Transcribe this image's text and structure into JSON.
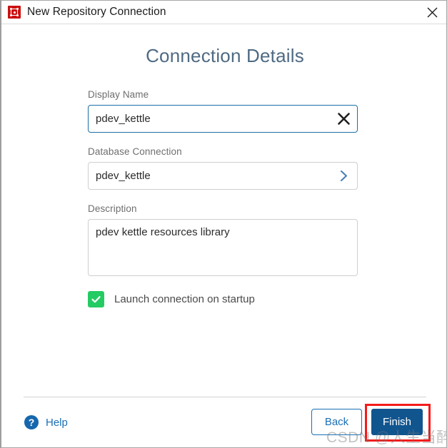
{
  "window": {
    "title": "New Repository Connection",
    "app_icon": "pentaho-kettle-icon",
    "close_label": "×"
  },
  "heading": "Connection Details",
  "form": {
    "fields": [
      {
        "label": "Display Name",
        "value": "pdev_kettle",
        "placeholder": "Display Name",
        "action_icon": "clear-icon",
        "focused": true,
        "type": "text"
      },
      {
        "label": "Database Connection",
        "value": "pdev_kettle",
        "placeholder": "Database Connection",
        "action_icon": "chevron-right-icon",
        "focused": false,
        "type": "select"
      },
      {
        "label": "Description",
        "value": "pdev kettle resources library",
        "placeholder": "Description",
        "type": "textarea"
      }
    ],
    "checkbox": {
      "label": "Launch connection on startup",
      "checked": true,
      "color": "#24cb63"
    }
  },
  "footer": {
    "help_label": "Help",
    "help_icon": "help-circle-icon",
    "back_label": "Back",
    "finish_label": "Finish"
  },
  "annotation": {
    "target": "finish-button",
    "color": "#f51a1a"
  },
  "watermark": "CSDN @人生当醉",
  "colors": {
    "accent_blue": "#1a6fb5",
    "primary_button": "#11558f",
    "heading": "#4f6a83",
    "checkbox_green": "#24cb63",
    "icon_red": "#cc1111",
    "annotation_red": "#f51a1a"
  }
}
